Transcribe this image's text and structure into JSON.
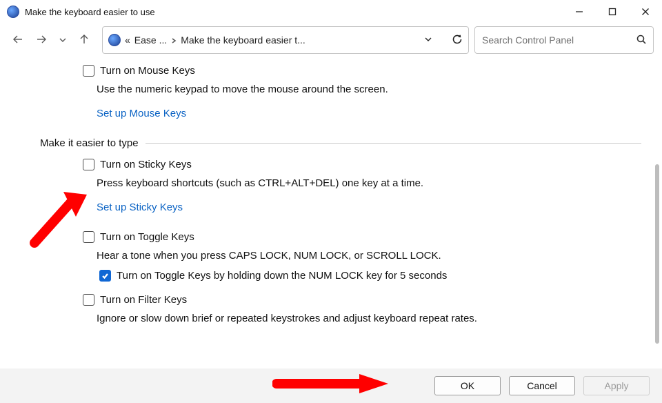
{
  "window": {
    "title": "Make the keyboard easier to use"
  },
  "breadcrumb": {
    "prefix": "«",
    "part1": "Ease ...",
    "part2": "Make the keyboard easier t..."
  },
  "search": {
    "placeholder": "Search Control Panel"
  },
  "mouse_keys": {
    "checkbox_label": "Turn on Mouse Keys",
    "desc": "Use the numeric keypad to move the mouse around the screen.",
    "link": "Set up Mouse Keys"
  },
  "section_type": {
    "heading": "Make it easier to type"
  },
  "sticky": {
    "checkbox_label": "Turn on Sticky Keys",
    "desc": "Press keyboard shortcuts (such as CTRL+ALT+DEL) one key at a time.",
    "link": "Set up Sticky Keys"
  },
  "toggle": {
    "checkbox_label": "Turn on Toggle Keys",
    "desc": "Hear a tone when you press CAPS LOCK, NUM LOCK, or SCROLL LOCK.",
    "sub_label": "Turn on Toggle Keys by holding down the NUM LOCK key for 5 seconds"
  },
  "filter": {
    "checkbox_label": "Turn on Filter Keys",
    "desc": "Ignore or slow down brief or repeated keystrokes and adjust keyboard repeat rates."
  },
  "buttons": {
    "ok": "OK",
    "cancel": "Cancel",
    "apply": "Apply"
  }
}
